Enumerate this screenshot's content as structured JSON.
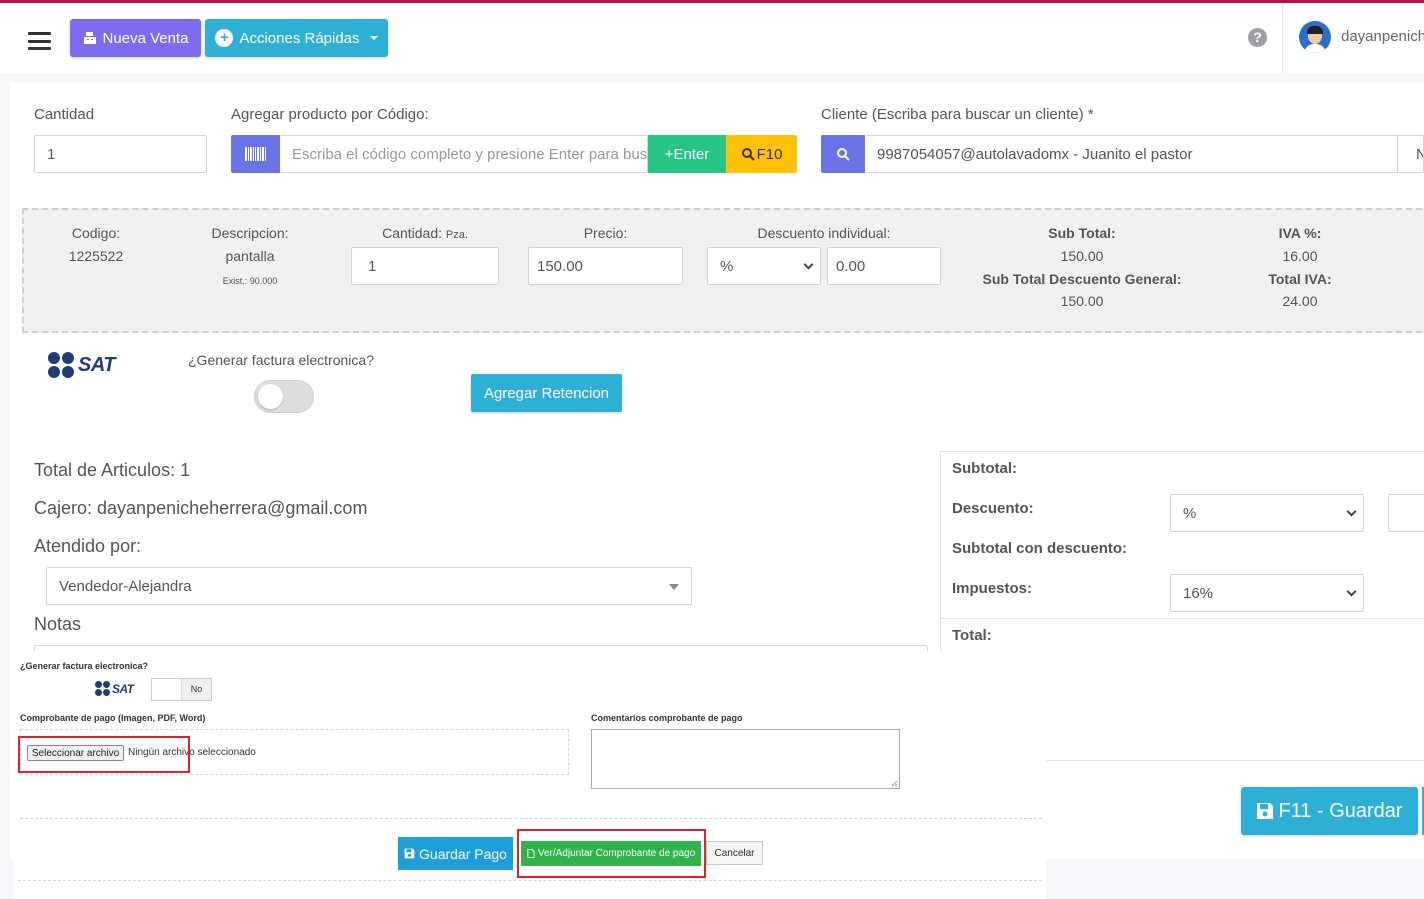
{
  "navbar": {
    "nueva_venta": "Nueva Venta",
    "acciones_rapidas": "Acciones Rápidas",
    "help_icon": "?",
    "username": "dayanpeniche"
  },
  "producto": {
    "cantidad_label": "Cantidad",
    "cantidad_value": "1",
    "codigo_label": "Agregar producto por Código:",
    "codigo_placeholder": "Escriba el código completo y presione Enter para buscar",
    "enter_label": "+Enter",
    "f10_label": "F10",
    "cliente_label": "Cliente (Escriba para buscar un cliente) *",
    "cliente_value": "9987054057@autolavadomx - Juanito el pastor",
    "cliente_next": "N"
  },
  "detalle": {
    "codigo_label": "Codigo:",
    "codigo_value": "1225522",
    "descripcion_label": "Descripcion:",
    "descripcion_value": "pantalla",
    "existencia": "Exist.: 90.000",
    "cantidad_label": "Cantidad:",
    "cantidad_unit": "Pza.",
    "cantidad_value": "1",
    "precio_label": "Precio:",
    "precio_value": "150.00",
    "descuento_label": "Descuento individual:",
    "descuento_tipo": "%",
    "descuento_value": "0.00",
    "subtotal_label": "Sub Total:",
    "subtotal_value": "150.00",
    "subtotal_desc_label": "Sub Total Descuento General:",
    "subtotal_desc_value": "150.00",
    "iva_label": "IVA %:",
    "iva_value": "16.00",
    "total_iva_label": "Total IVA:",
    "total_iva_value": "24.00"
  },
  "factura": {
    "sat_text": "SAT",
    "pregunta": "¿Generar factura electronica?",
    "agregar_retencion": "Agregar Retencion"
  },
  "resumen": {
    "total_articulos": "Total de Articulos: 1",
    "cajero": "Cajero: dayanpenicheherrera@gmail.com",
    "atendido_label": "Atendido por:",
    "atendido_value": "Vendedor-Alejandra",
    "notas_label": "Notas"
  },
  "totales": {
    "subtotal_label": "Subtotal:",
    "descuento_label": "Descuento:",
    "descuento_tipo": "%",
    "subtotal_desc_label": "Subtotal con descuento:",
    "impuestos_label": "Impuestos:",
    "impuestos_value": "16%",
    "total_label": "Total:",
    "guardar_label": "F11 - Guardar"
  },
  "modal": {
    "pregunta": "¿Generar factura electronica?",
    "sat_text": "SAT",
    "toggle_state": "No",
    "comprobante_label": "Comprobante de pago (Imagen, PDF, Word)",
    "seleccionar_archivo": "Seleccionar archivo",
    "ningun_archivo": "Ningún archivo seleccionado",
    "comentarios_label": "Comentarios comprobante de pago",
    "guardar_pago": "Guardar Pago",
    "ver_adjuntar": "Ver/Adjuntar Comprobante de pago",
    "cancelar": "Cancelar"
  },
  "colors": {
    "accent_purple": "#7b6cf0",
    "accent_cyan": "#2eb0d6",
    "accent_green": "#27c486",
    "accent_yellow": "#ffc107",
    "highlight_red": "#d9242a"
  }
}
